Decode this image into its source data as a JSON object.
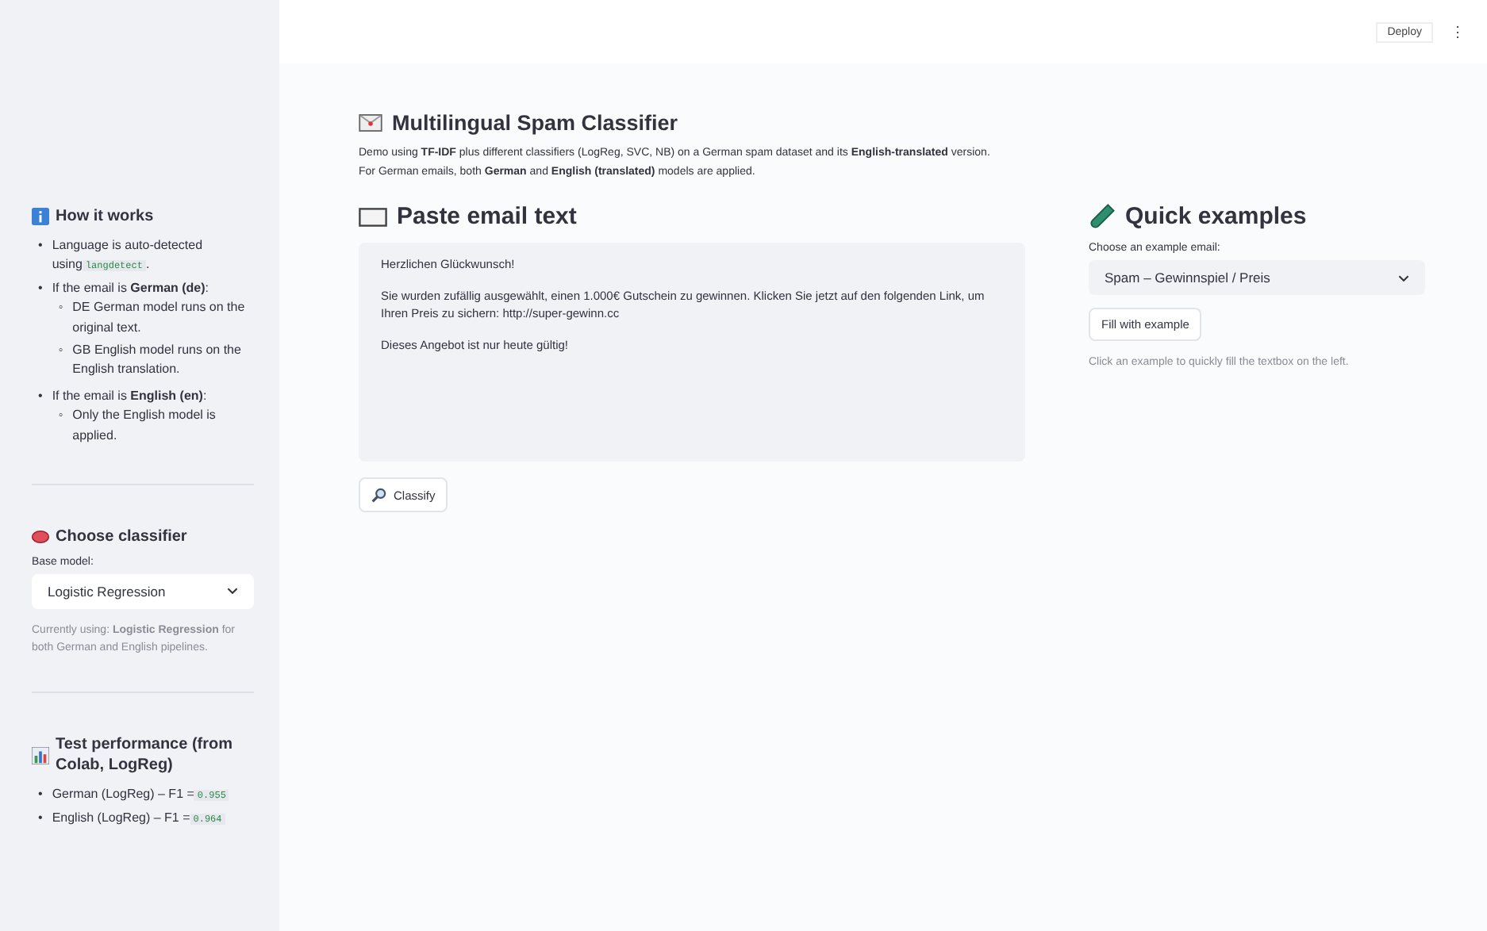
{
  "header": {
    "deploy": "Deploy",
    "menu": "⋮"
  },
  "sidebar": {
    "sections": [
      {
        "kind": "list",
        "title": "How it works",
        "items": [
          {
            "marker": "•",
            "text": "Language is auto-detected using",
            "code": "langdetect",
            "after": "."
          },
          {
            "marker": "•",
            "text": "If the email is **German (de)**:",
            "children": [
              {
                "marker": "◦",
                "text": "DE German model runs on the original text."
              },
              {
                "marker": "◦",
                "text": "GB English model runs on the English translation."
              }
            ]
          },
          {
            "marker": "•",
            "text": "If the email is **English (en)**:",
            "children": [
              {
                "marker": "◦",
                "text": "Only the English model is applied."
              }
            ]
          }
        ]
      },
      {
        "kind": "select",
        "title": "Choose classifier",
        "label": "Base model:",
        "value": "Logistic Regression",
        "caption": "Currently using: **Logistic Regression** for both German and English pipelines."
      },
      {
        "kind": "list",
        "title": "Test performance (from Colab, LogReg)",
        "items": [
          {
            "marker": "•",
            "text": "German (LogReg) – F1 =",
            "code": "0.955"
          },
          {
            "marker": "•",
            "text": "English (LogReg) – F1 =",
            "code": "0.964"
          }
        ]
      }
    ]
  },
  "main": {
    "title": "Multilingual Spam Classifier",
    "intro": [
      "Demo using **TF-IDF** plus different classifiers (LogReg, SVC, NB) on a German spam dataset and its **English-translated** version.",
      "For German emails, both **German** and **English (translated)** models are applied."
    ],
    "paste": {
      "heading": "Paste email text",
      "paragraphs": [
        "Herzlichen Glückwunsch!",
        "Sie wurden zufällig ausgewählt, einen 1.000€ Gutschein zu gewinnen. Klicken Sie jetzt auf den folgenden Link, um Ihren Preis zu sichern: http://super-gewinn.cc",
        "Dieses Angebot ist nur heute gültig!"
      ],
      "button": "Classify"
    },
    "examples": {
      "heading": "Quick examples",
      "label": "Choose an example email:",
      "value": "Spam – Gewinnspiel / Preis",
      "button": "Fill with example",
      "caption": "Click an example to quickly fill the textbox on the left."
    }
  }
}
